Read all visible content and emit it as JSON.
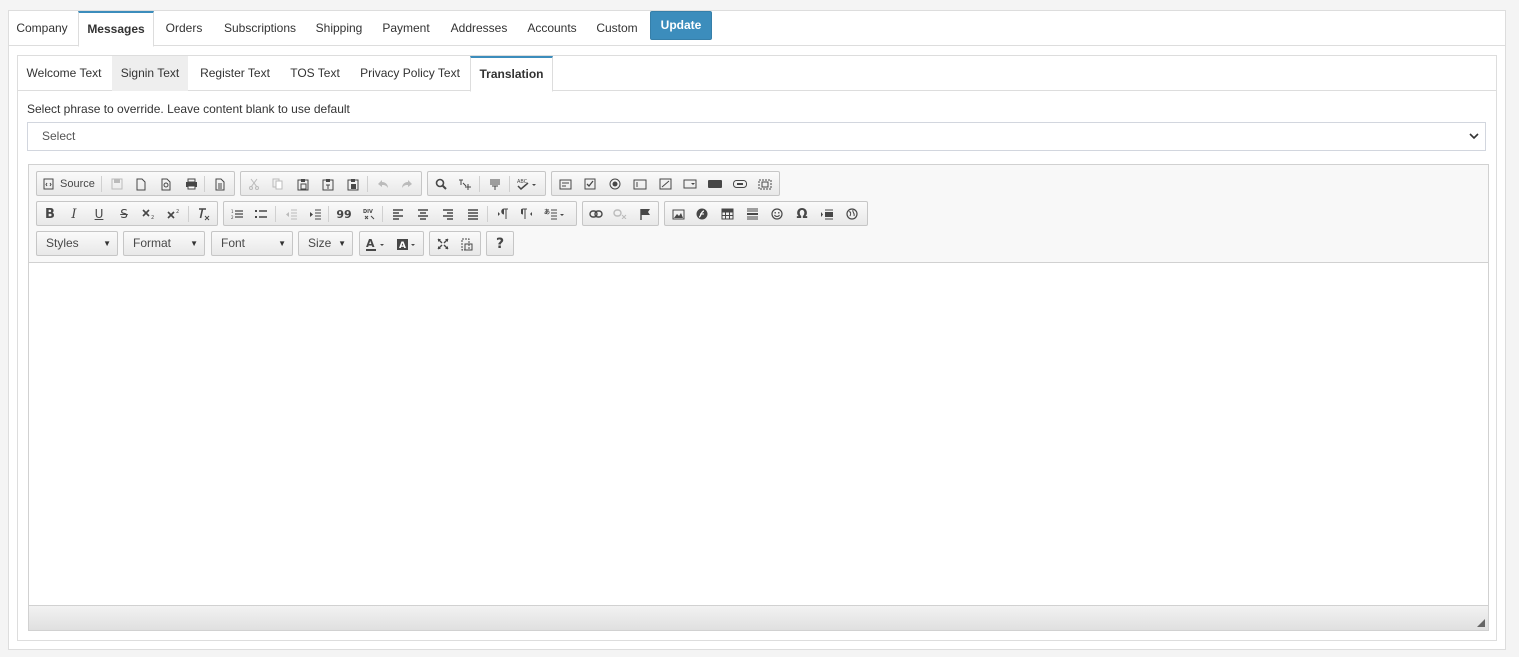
{
  "top_tabs": [
    "Company",
    "Messages",
    "Orders",
    "Subscriptions",
    "Shipping",
    "Payment",
    "Addresses",
    "Accounts",
    "Custom"
  ],
  "update_label": "Update",
  "sub_tabs": [
    "Welcome Text",
    "Signin Text",
    "Register Text",
    "TOS Text",
    "Privacy Policy Text",
    "Translation"
  ],
  "hint": "Select phrase to override. Leave content blank to use default",
  "select_value": "Select",
  "toolbar": {
    "source_label": "Source",
    "bold_label": "B",
    "italic_label": "I",
    "underline_label": "U",
    "strike_label": "S",
    "styles_label": "Styles",
    "format_label": "Format",
    "font_label": "Font",
    "size_label": "Size",
    "help_label": "?",
    "quote_label": "99",
    "omega_label": "Ω"
  },
  "colors": {
    "accent": "#3c8dbc"
  }
}
